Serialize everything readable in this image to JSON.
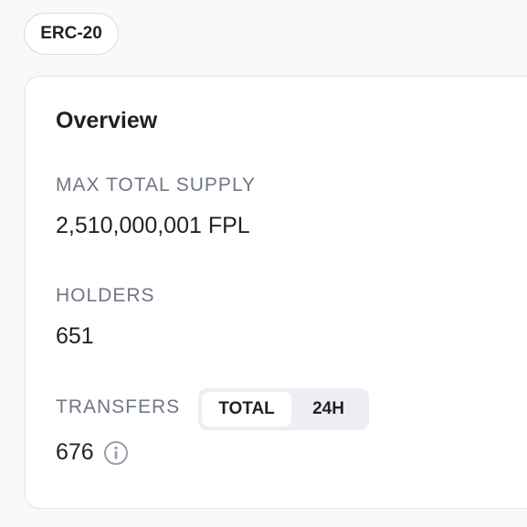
{
  "badge": {
    "label": "ERC-20"
  },
  "overview": {
    "title": "Overview",
    "max_total_supply": {
      "label": "MAX TOTAL SUPPLY",
      "value": "2,510,000,001 FPL"
    },
    "holders": {
      "label": "HOLDERS",
      "value": "651"
    },
    "transfers": {
      "label": "TRANSFERS",
      "value": "676",
      "toggle": {
        "options": [
          "TOTAL",
          "24H"
        ],
        "selected": "TOTAL"
      },
      "info_icon": "info-circle-icon"
    }
  },
  "colors": {
    "label_gray": "#707782",
    "text_dark": "#1f2125",
    "toggle_bg": "#eceef1",
    "border": "#e3e5e8"
  }
}
